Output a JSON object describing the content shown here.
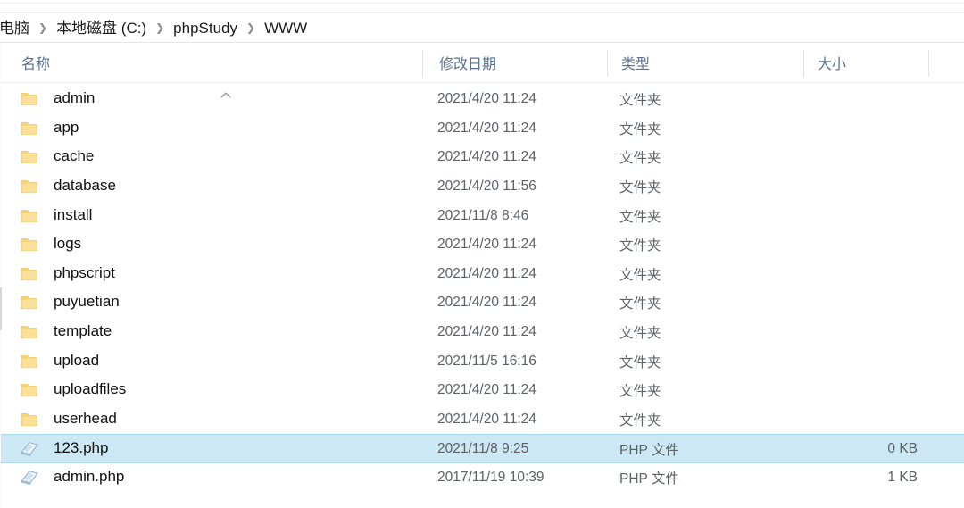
{
  "window": {
    "title": "WWW"
  },
  "breadcrumb": {
    "name": "address-breadcrumb",
    "items": [
      {
        "label": "电脑"
      },
      {
        "label": "本地磁盘 (C:)"
      },
      {
        "label": "phpStudy"
      },
      {
        "label": "WWW"
      }
    ],
    "separator": "❯"
  },
  "columns": {
    "name": "名称",
    "date_modified": "修改日期",
    "type": "类型",
    "size": "大小",
    "sort_indicator": "︿",
    "sorted_by": "名称",
    "sort_direction": "ascending"
  },
  "colors": {
    "selection_fill": "#cce8f4",
    "selection_border": "#a9d7ea",
    "header_text": "#5b7290",
    "row_text": "#111111",
    "secondary_text": "#5e6266",
    "folder_icon": "#f5d073",
    "php_icon": "#bcd9ec"
  },
  "files": [
    {
      "name": "admin",
      "date": "2021/4/20 11:24",
      "type": "文件夹",
      "size": "",
      "icon": "folder-icon",
      "selected": false
    },
    {
      "name": "app",
      "date": "2021/4/20 11:24",
      "type": "文件夹",
      "size": "",
      "icon": "folder-icon",
      "selected": false
    },
    {
      "name": "cache",
      "date": "2021/4/20 11:24",
      "type": "文件夹",
      "size": "",
      "icon": "folder-icon",
      "selected": false
    },
    {
      "name": "database",
      "date": "2021/4/20 11:56",
      "type": "文件夹",
      "size": "",
      "icon": "folder-icon",
      "selected": false
    },
    {
      "name": "install",
      "date": "2021/11/8 8:46",
      "type": "文件夹",
      "size": "",
      "icon": "folder-icon",
      "selected": false
    },
    {
      "name": "logs",
      "date": "2021/4/20 11:24",
      "type": "文件夹",
      "size": "",
      "icon": "folder-icon",
      "selected": false
    },
    {
      "name": "phpscript",
      "date": "2021/4/20 11:24",
      "type": "文件夹",
      "size": "",
      "icon": "folder-icon",
      "selected": false
    },
    {
      "name": "puyuetian",
      "date": "2021/4/20 11:24",
      "type": "文件夹",
      "size": "",
      "icon": "folder-icon",
      "selected": false
    },
    {
      "name": "template",
      "date": "2021/4/20 11:24",
      "type": "文件夹",
      "size": "",
      "icon": "folder-icon",
      "selected": false
    },
    {
      "name": "upload",
      "date": "2021/11/5 16:16",
      "type": "文件夹",
      "size": "",
      "icon": "folder-icon",
      "selected": false
    },
    {
      "name": "uploadfiles",
      "date": "2021/4/20 11:24",
      "type": "文件夹",
      "size": "",
      "icon": "folder-icon",
      "selected": false
    },
    {
      "name": "userhead",
      "date": "2021/4/20 11:24",
      "type": "文件夹",
      "size": "",
      "icon": "folder-icon",
      "selected": false
    },
    {
      "name": "123.php",
      "date": "2021/11/8 9:25",
      "type": "PHP 文件",
      "size": "0 KB",
      "icon": "php-file-icon",
      "selected": true
    },
    {
      "name": "admin.php",
      "date": "2017/11/19 10:39",
      "type": "PHP 文件",
      "size": "1 KB",
      "icon": "php-file-icon",
      "selected": false
    }
  ]
}
